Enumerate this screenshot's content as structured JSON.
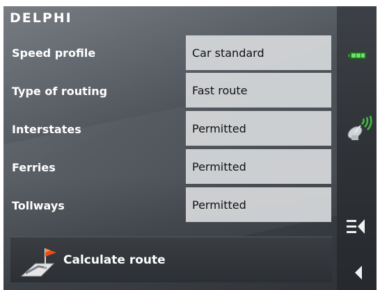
{
  "brand": "DELPHI",
  "settings": {
    "rows": [
      {
        "label": "Speed profile",
        "value": "Car standard"
      },
      {
        "label": "Type of routing",
        "value": "Fast route"
      },
      {
        "label": "Interstates",
        "value": "Permitted"
      },
      {
        "label": "Ferries",
        "value": "Permitted"
      },
      {
        "label": "Tollways",
        "value": "Permitted"
      }
    ]
  },
  "actions": {
    "calculate_label": "Calculate route"
  },
  "sidebar": {
    "icons": [
      "battery-icon",
      "gps-satellite-icon",
      "menu-back-icon",
      "back-arrow-icon"
    ]
  },
  "colors": {
    "value_box": "#d6d8da",
    "battery": "#3fbf3f",
    "gps_signal": "#3fbf3f"
  }
}
